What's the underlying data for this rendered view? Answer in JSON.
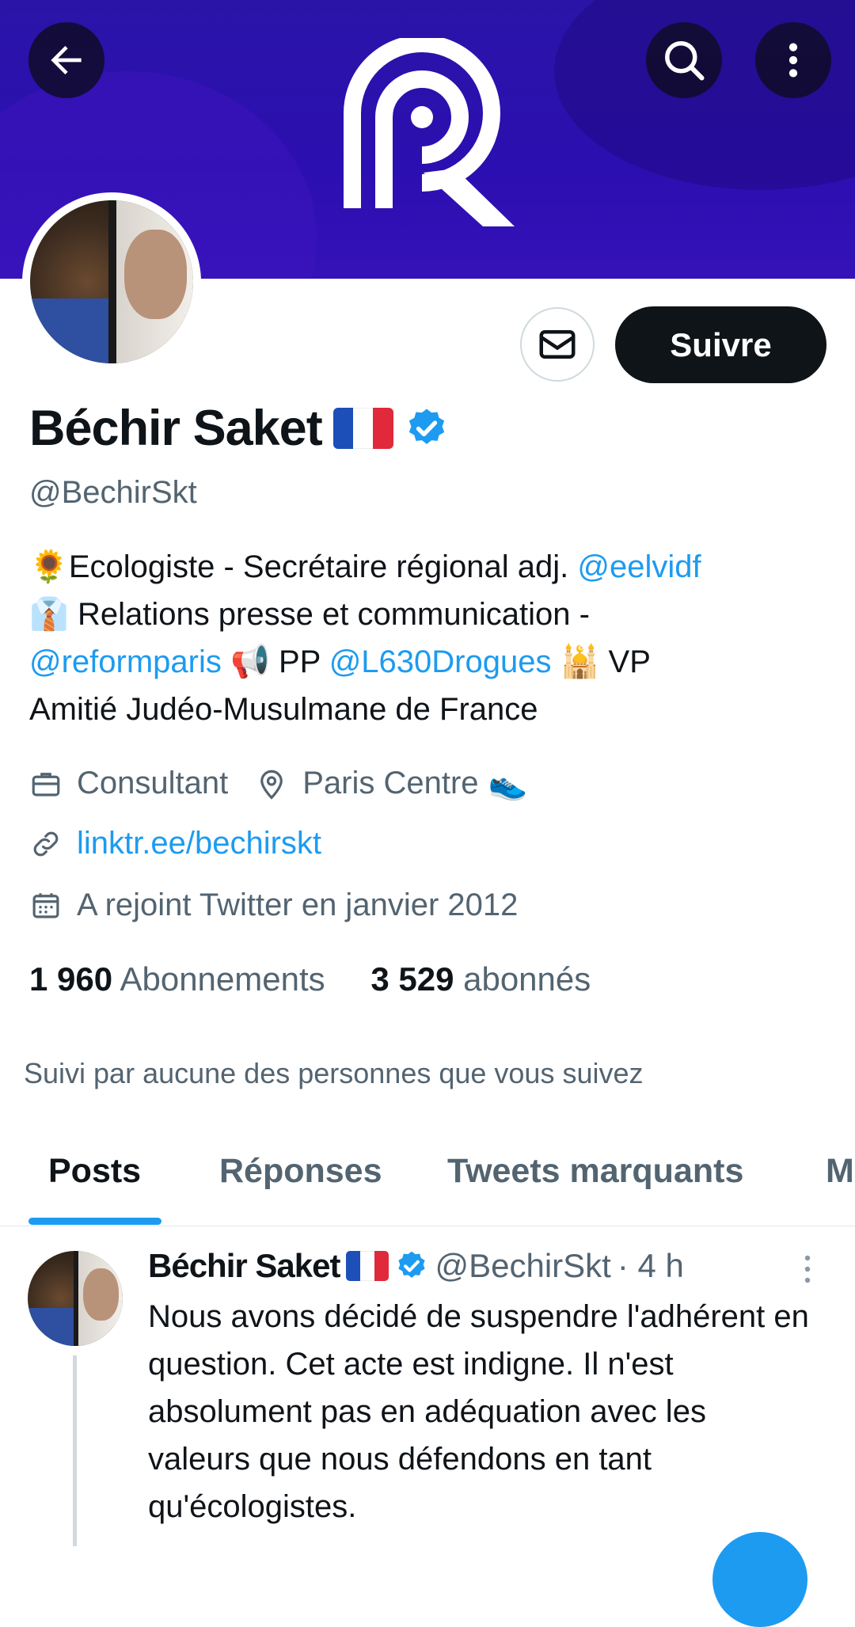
{
  "header": {
    "back_icon": "arrow-left-icon",
    "search_icon": "search-icon",
    "more_icon": "more-vertical-icon",
    "banner_logo": "PR"
  },
  "profile": {
    "name": "Béchir Saket",
    "flag": "france-flag",
    "verified": true,
    "handle": "@BechirSkt",
    "message_icon": "envelope-icon",
    "follow_label": "Suivre",
    "bio": {
      "line1_text": "Ecologiste - Secrétaire régional adj.",
      "line1_link": "@eelvidf",
      "line2_text": "Relations presse et communication -",
      "line3_link1": "@reformparis",
      "line3_text": "PP",
      "line3_link2": "@L630Drogues",
      "line3_text2": "VP",
      "line4_text": "Amitié Judéo-Musulmane de France"
    },
    "job": "Consultant",
    "location": "Paris Centre",
    "website": "linktr.ee/bechirskt",
    "joined": "A rejoint Twitter en janvier 2012",
    "following_count": "1 960",
    "following_label": "Abonnements",
    "followers_count": "3 529",
    "followers_label": "abonnés",
    "followed_by": "Suivi par aucune des personnes que vous suivez"
  },
  "tabs": [
    {
      "label": "Posts",
      "active": true
    },
    {
      "label": "Réponses",
      "active": false
    },
    {
      "label": "Tweets marquants",
      "active": false
    },
    {
      "label": "M",
      "active": false
    }
  ],
  "post": {
    "author": "Béchir Saket",
    "handle": "@BechirSkt",
    "time": "· 4 h",
    "text": "Nous avons décidé de suspendre l'adhérent en question. Cet acte est indigne. Il n'est absolument pas en adéquation avec les valeurs que nous défendons en tant qu'écologistes."
  },
  "colors": {
    "banner": "#2c0fb0",
    "accent": "#1d9bf0",
    "text": "#0f1419",
    "muted": "#536471"
  }
}
